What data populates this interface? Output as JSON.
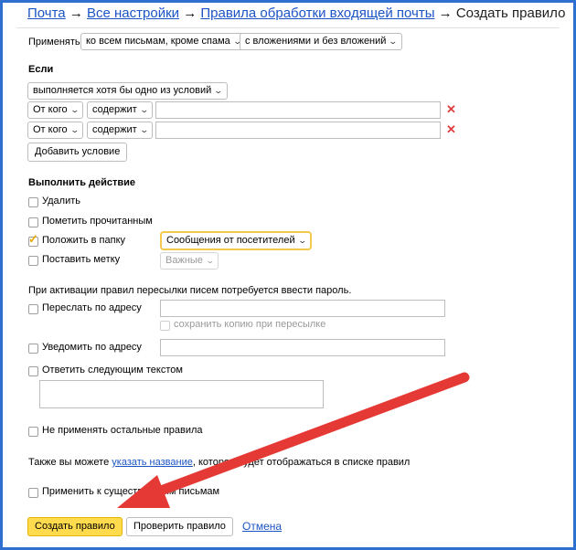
{
  "breadcrumbs": {
    "items": [
      "Почта",
      "Все настройки",
      "Правила обработки входящей почты"
    ],
    "separator": "→",
    "current": "Создать правило"
  },
  "apply_row": {
    "label": "Применять",
    "scope_select": "ко всем письмам, кроме спама",
    "attachments_select": "с вложениями и без вложений"
  },
  "conditions": {
    "heading": "Если",
    "mode_select": "выполняется хотя бы одно из условий",
    "rows": [
      {
        "field": "От кого",
        "op": "содержит",
        "value": ""
      },
      {
        "field": "От кого",
        "op": "содержит",
        "value": ""
      }
    ],
    "add_button": "Добавить условие",
    "remove_symbol": "✕"
  },
  "actions": {
    "heading": "Выполнить действие",
    "delete": {
      "label": "Удалить",
      "checked": false
    },
    "mark_read": {
      "label": "Пометить прочитанным",
      "checked": false
    },
    "move_folder": {
      "label": "Положить в папку",
      "checked": true,
      "folder": "Сообщения от посетителей"
    },
    "set_label": {
      "label": "Поставить метку",
      "checked": false,
      "tag": "Важные"
    }
  },
  "forward": {
    "note": "При активации правил пересылки писем потребуется ввести пароль.",
    "forward_to": {
      "label": "Переслать по адресу",
      "value": ""
    },
    "keep_copy": {
      "label": "сохранить копию при пересылке"
    },
    "notify_to": {
      "label": "Уведомить по адресу",
      "value": ""
    },
    "reply_text": {
      "label": "Ответить следующим текстом",
      "value": ""
    }
  },
  "extra": {
    "stop_rules": {
      "label": "Не применять остальные правила"
    },
    "name_note_before": "Также вы можете",
    "name_note_link": "указать название",
    "name_note_after": ", которое будет отображаться в списке правил",
    "apply_existing": {
      "label": "Применить к существующим письмам"
    }
  },
  "footer": {
    "create": "Создать правило",
    "check": "Проверить правило",
    "cancel": "Отмена"
  },
  "colors": {
    "link": "#1b54c4",
    "primary_button": "#ffdb4d",
    "annotation_arrow": "#e53935",
    "frame": "#2f6fcf"
  }
}
